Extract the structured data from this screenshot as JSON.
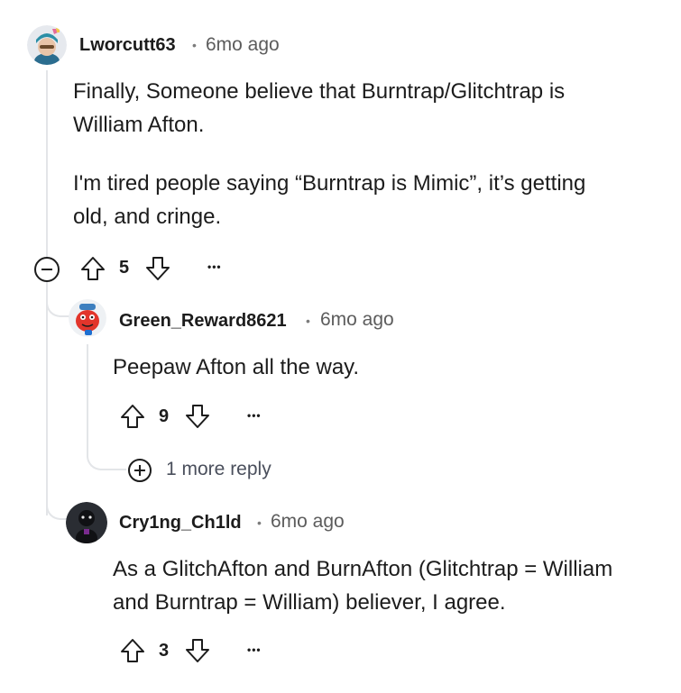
{
  "comments": [
    {
      "username": "Lworcutt63",
      "separator": "•",
      "time": "6mo ago",
      "paragraphs": [
        "Finally, Someone believe that Burntrap/Glitchtrap is",
        "William Afton.",
        "I'm tired people saying “Burntrap is Mimic”, it’s getting",
        "old, and cringe."
      ],
      "score": "5",
      "more": "•••"
    },
    {
      "username": "Green_Reward8621",
      "separator": "•",
      "time": "6mo ago",
      "paragraphs": [
        "Peepaw Afton all the way."
      ],
      "score": "9",
      "more": "•••",
      "more_replies": "1 more reply"
    },
    {
      "username": "Cry1ng_Ch1ld",
      "separator": "•",
      "time": "6mo ago",
      "paragraphs": [
        "As a GlitchAfton and BurnAfton (Glitchtrap = William",
        "and Burntrap = William) believer, I agree."
      ],
      "score": "3",
      "more": "•••"
    }
  ],
  "colors": {
    "thread_line": "#e3e5e8",
    "icon_stroke": "#1c1c1c",
    "meta_text": "#5c5c5c"
  }
}
